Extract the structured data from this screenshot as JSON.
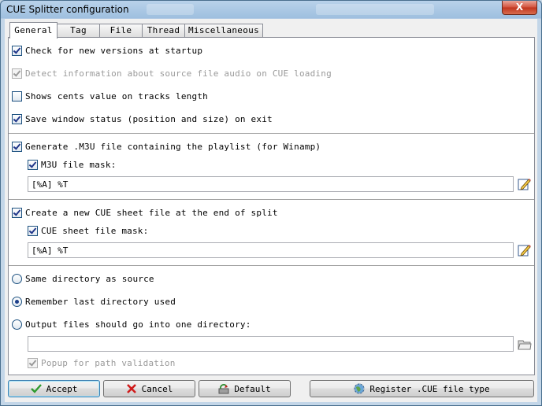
{
  "window": {
    "title": "CUE Splitter configuration",
    "close_symbol": "X"
  },
  "tabs": [
    {
      "label": "General",
      "active": true
    },
    {
      "label": "Tag",
      "active": false
    },
    {
      "label": "File",
      "active": false
    },
    {
      "label": "Thread",
      "active": false
    },
    {
      "label": "Miscellaneous",
      "active": false
    }
  ],
  "general": {
    "check_new_versions": {
      "label": "Check for new versions at startup",
      "checked": true
    },
    "detect_audio_info": {
      "label": "Detect information about source file audio on CUE loading",
      "checked": true,
      "disabled": true
    },
    "show_cents": {
      "label": "Shows cents value on tracks length",
      "checked": false
    },
    "save_window_status": {
      "label": "Save window status (position and size) on exit",
      "checked": true
    },
    "generate_m3u": {
      "label": "Generate .M3U file containing the playlist (for Winamp)",
      "checked": true
    },
    "m3u_mask": {
      "label": "M3U file mask:",
      "checked": true,
      "value": "[%A] %T"
    },
    "create_cue": {
      "label": "Create a new CUE sheet file at the end of split",
      "checked": true
    },
    "cue_mask": {
      "label": "CUE sheet file mask:",
      "checked": true,
      "value": "[%A] %T"
    },
    "output_same_dir": {
      "label": "Same directory as source",
      "selected": false
    },
    "output_remember": {
      "label": "Remember last directory used",
      "selected": true
    },
    "output_one_dir": {
      "label": "Output files should go into one directory:",
      "selected": false
    },
    "output_dir_value": "",
    "popup_validation": {
      "label": "Popup for path validation",
      "checked": true,
      "disabled": true
    }
  },
  "buttons": {
    "accept": "Accept",
    "cancel": "Cancel",
    "default": "Default",
    "register": "Register .CUE file type"
  },
  "icons": {
    "edit_mask": "pencil-edit-icon",
    "browse_folder": "folder-icon",
    "accept": "green-check-icon",
    "cancel": "red-x-icon",
    "default": "reset-icon",
    "register": "globe-icon"
  }
}
